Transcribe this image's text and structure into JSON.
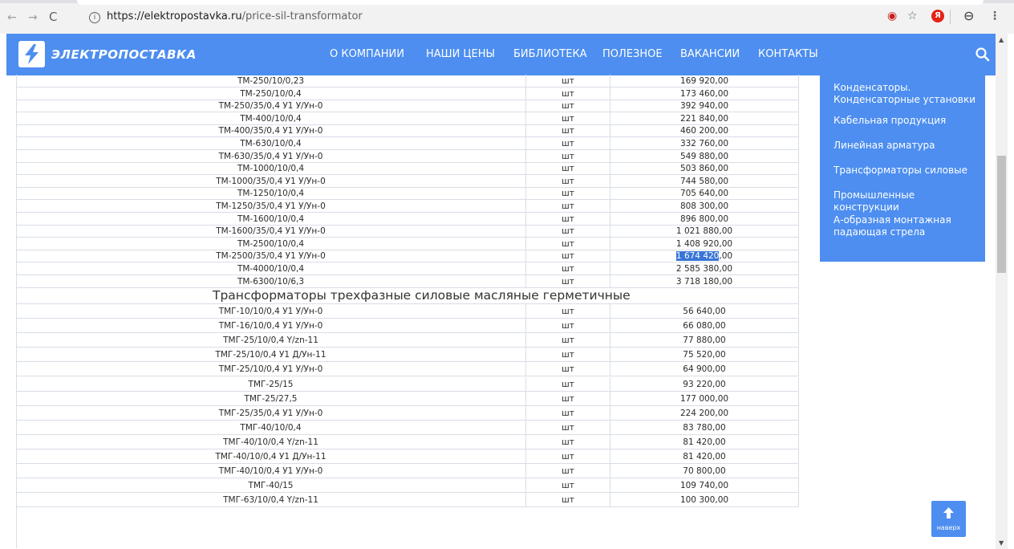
{
  "browser": {
    "url_domain": "https://elektropostavka.ru",
    "url_path": "/price-sil-transformator"
  },
  "site": {
    "logo_text": "ЭЛЕКТРОПОСТАВКА",
    "menu": [
      "О КОМПАНИИ",
      "НАШИ ЦЕНЫ",
      "БИБЛИОТЕКА",
      "ПОЛЕЗНОЕ",
      "ВАКАНСИИ",
      "КОНТАКТЫ"
    ]
  },
  "table": {
    "rows_top": [
      {
        "name": "ТМ-250/10/0,23",
        "unit": "шт",
        "price": "169 920,00"
      },
      {
        "name": "ТМ-250/10/0,4",
        "unit": "шт",
        "price": "173 460,00"
      },
      {
        "name": "ТМ-250/35/0,4 У1 У/Ун-0",
        "unit": "шт",
        "price": "392 940,00"
      },
      {
        "name": "ТМ-400/10/0,4",
        "unit": "шт",
        "price": "221 840,00"
      },
      {
        "name": "ТМ-400/35/0,4 У1 У/Ун-0",
        "unit": "шт",
        "price": "460 200,00"
      },
      {
        "name": "ТМ-630/10/0,4",
        "unit": "шт",
        "price": "332 760,00"
      },
      {
        "name": "ТМ-630/35/0,4 У1 У/Ун-0",
        "unit": "шт",
        "price": "549 880,00"
      },
      {
        "name": "ТМ-1000/10/0,4",
        "unit": "шт",
        "price": "503 860,00"
      },
      {
        "name": "ТМ-1000/35/0,4 У1 У/Ун-0",
        "unit": "шт",
        "price": "744 580,00"
      },
      {
        "name": "ТМ-1250/10/0,4",
        "unit": "шт",
        "price": "705 640,00"
      },
      {
        "name": "ТМ-1250/35/0,4 У1 У/Ун-0",
        "unit": "шт",
        "price": "808 300,00"
      },
      {
        "name": "ТМ-1600/10/0,4",
        "unit": "шт",
        "price": "896 800,00"
      },
      {
        "name": "ТМ-1600/35/0,4 У1 У/Ун-0",
        "unit": "шт",
        "price": "1 021 880,00"
      },
      {
        "name": "ТМ-2500/10/0,4",
        "unit": "шт",
        "price": "1 408 920,00"
      },
      {
        "name": "ТМ-2500/35/0,4 У1 У/Ун-0",
        "unit": "шт",
        "price": "1 674 420,00",
        "price_selected": "1 674 420",
        "price_rest": ",00"
      },
      {
        "name": "ТМ-4000/10/0,4",
        "unit": "шт",
        "price": "2 585 380,00"
      },
      {
        "name": "ТМ-6300/10/6,3",
        "unit": "шт",
        "price": "3 718 180,00"
      }
    ],
    "section_title": "Трансформаторы трехфазные силовые масляные герметичные",
    "rows_bottom": [
      {
        "name": "ТМГ-10/10/0,4 У1 У/Ун-0",
        "unit": "шт",
        "price": "56 640,00"
      },
      {
        "name": "ТМГ-16/10/0,4 У1 У/Ун-0",
        "unit": "шт",
        "price": "66 080,00"
      },
      {
        "name": "ТМГ-25/10/0,4 Y/zn-11",
        "unit": "шт",
        "price": "77 880,00"
      },
      {
        "name": "ТМГ-25/10/0,4 У1 Д/Ун-11",
        "unit": "шт",
        "price": "75 520,00"
      },
      {
        "name": "ТМГ-25/10/0,4 У1 У/Ун-0",
        "unit": "шт",
        "price": "64 900,00"
      },
      {
        "name": "ТМГ-25/15",
        "unit": "шт",
        "price": "93 220,00"
      },
      {
        "name": "ТМГ-25/27,5",
        "unit": "шт",
        "price": "177 000,00"
      },
      {
        "name": "ТМГ-25/35/0,4 У1 У/Ун-0",
        "unit": "шт",
        "price": "224 200,00"
      },
      {
        "name": "ТМГ-40/10/0,4",
        "unit": "шт",
        "price": "83 780,00"
      },
      {
        "name": "ТМГ-40/10/0,4 Y/zn-11",
        "unit": "шт",
        "price": "81 420,00"
      },
      {
        "name": "ТМГ-40/10/0,4 У1 Д/Ун-11",
        "unit": "шт",
        "price": "81 420,00"
      },
      {
        "name": "ТМГ-40/10/0,4 У1 У/Ун-0",
        "unit": "шт",
        "price": "70 800,00"
      },
      {
        "name": "ТМГ-40/15",
        "unit": "шт",
        "price": "109 740,00"
      },
      {
        "name": "ТМГ-63/10/0,4 Y/zn-11",
        "unit": "шт",
        "price": "100 300,00"
      }
    ]
  },
  "sidebar": {
    "items": [
      "Конденсаторы. Конденсаторные установки",
      "Кабельная продукция",
      "Линейная арматура",
      "Трансформаторы силовые",
      "Промышленные конструкции",
      "А-образная монтажная падающая стрела"
    ]
  },
  "up_button": {
    "label": "наверх"
  },
  "colors": {
    "brand_blue": "#4d8ef0",
    "selection": "#3875d7"
  }
}
